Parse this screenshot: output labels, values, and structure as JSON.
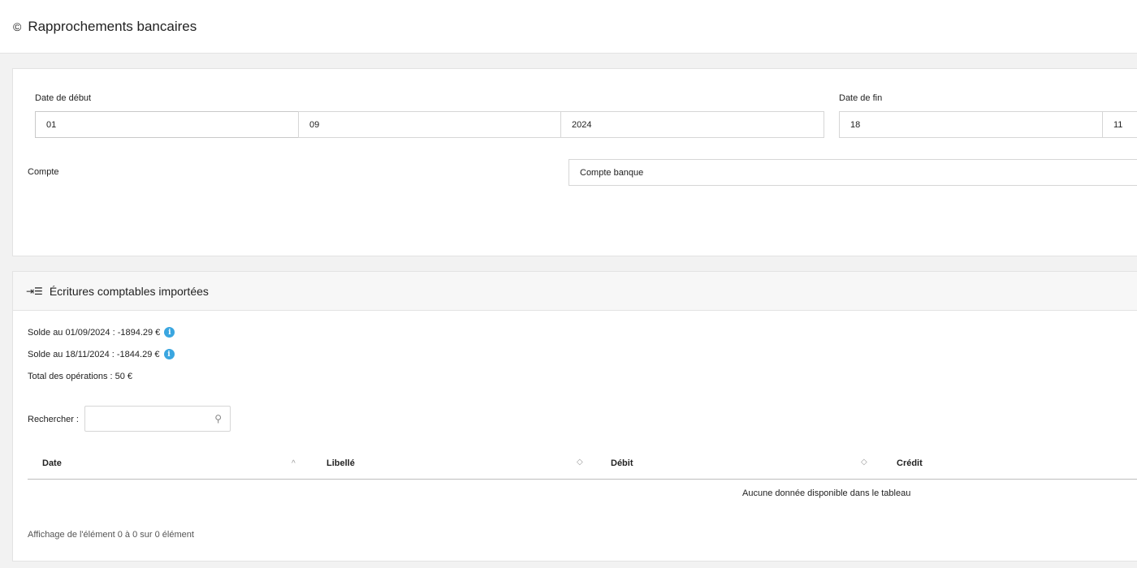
{
  "header": {
    "icon": "copyright-icon",
    "title": "Rapprochements bancaires"
  },
  "filters": {
    "start_label": "Date de début",
    "start_day": "01",
    "start_month": "09",
    "start_year": "2024",
    "end_label": "Date de fin",
    "end_day": "18",
    "end_month": "11",
    "account_label": "Compte",
    "account_value": "Compte banque"
  },
  "entries": {
    "icon": "import-list-icon",
    "title": "Écritures comptables importées",
    "balance_start": "Solde au 01/09/2024 : -1894.29 €",
    "balance_end": "Solde au 18/11/2024 : -1844.29 €",
    "total": "Total des opérations : 50 €",
    "search_label": "Rechercher :",
    "search_value": "",
    "columns": [
      "Date",
      "Libellé",
      "Débit",
      "Crédit"
    ],
    "empty_message": "Aucune donnée disponible dans le tableau",
    "footer": "Affichage de l'élément 0 à 0 sur 0 élément"
  },
  "colors": {
    "info": "#3aa6e0",
    "background": "#f2f2f2"
  }
}
